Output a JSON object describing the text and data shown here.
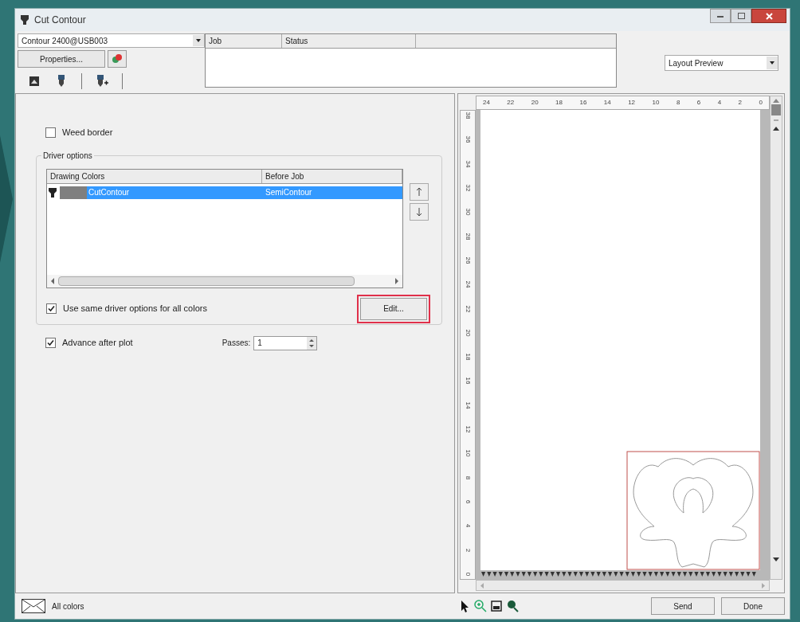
{
  "window": {
    "title": "Cut Contour"
  },
  "printer_select": {
    "value": "Contour 2400@USB003"
  },
  "properties_button": "Properties...",
  "job_table": {
    "columns": [
      "Job",
      "Status"
    ]
  },
  "view_select": {
    "value": "Layout Preview"
  },
  "weed_border": {
    "label": "Weed border",
    "checked": false
  },
  "driver_options": {
    "title": "Driver options",
    "columns": [
      "Drawing Colors",
      "Before Job"
    ],
    "rows": [
      {
        "color_name": "CutContour",
        "before_job": "SemiContour",
        "selected": true,
        "color": "#7f7f7f"
      }
    ],
    "same_options": {
      "label": "Use same driver options for all colors",
      "checked": true
    },
    "edit_button": {
      "label": "Edit...",
      "highlighted": true
    }
  },
  "advance_after_plot": {
    "label": "Advance after plot",
    "checked": true
  },
  "passes": {
    "label": "Passes:",
    "value": "1"
  },
  "ruler": {
    "x_labels": [
      "24",
      "22",
      "20",
      "18",
      "16",
      "14",
      "12",
      "10",
      "8",
      "6",
      "4",
      "2",
      "0"
    ],
    "y_labels": [
      "38",
      "36",
      "34",
      "32",
      "30",
      "28",
      "26",
      "24",
      "22",
      "20",
      "18",
      "16",
      "14",
      "12",
      "10",
      "8",
      "6",
      "4",
      "2",
      "0"
    ]
  },
  "status": {
    "label": "All colors"
  },
  "buttons": [
    "Send",
    "Done"
  ]
}
